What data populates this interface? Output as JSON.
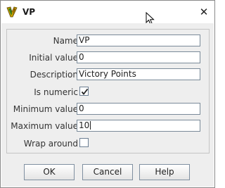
{
  "window": {
    "title": "VP",
    "app_icon": "vassal-app-icon",
    "close_symbol": "✕"
  },
  "form": {
    "name": {
      "label": "Name",
      "value": "VP"
    },
    "initial_value": {
      "label": "Initial value",
      "value": "0"
    },
    "description": {
      "label": "Description",
      "value": "Victory Points"
    },
    "is_numeric": {
      "label": "Is numeric",
      "checked": true
    },
    "minimum_value": {
      "label": "Minimum value",
      "value": "0"
    },
    "maximum_value": {
      "label": "Maximum value",
      "value": "10"
    },
    "wrap_around": {
      "label": "Wrap around",
      "checked": false
    }
  },
  "buttons": {
    "ok": "OK",
    "cancel": "Cancel",
    "help": "Help"
  },
  "colors": {
    "panel_background": "#eeeeee",
    "field_border": "#7a8a99",
    "checkbox_border": "#6d7f93"
  }
}
